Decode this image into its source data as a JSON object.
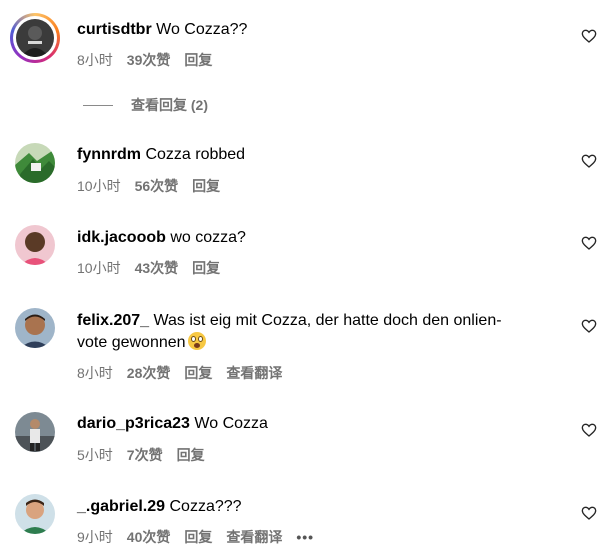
{
  "replies_link": "查看回复 (2)",
  "comments": [
    {
      "username": "curtisdtbr",
      "text": "Wo Cozza??",
      "time": "8小时",
      "likes": "39次赞",
      "reply": "回复"
    },
    {
      "username": "fynnrdm",
      "text": "Cozza robbed",
      "time": "10小时",
      "likes": "56次赞",
      "reply": "回复"
    },
    {
      "username": "idk.jacooob",
      "text": "wo cozza?",
      "time": "10小时",
      "likes": "43次赞",
      "reply": "回复"
    },
    {
      "username": "felix.207_",
      "text_line1": "Was ist eig mit Cozza, der hatte doch den onlien-",
      "text_line2": "vote gewonnen",
      "time": "8小时",
      "likes": "28次赞",
      "reply": "回复",
      "translate": "查看翻译"
    },
    {
      "username": "dario_p3rica23",
      "text": "Wo Cozza",
      "time": "5小时",
      "likes": "7次赞",
      "reply": "回复"
    },
    {
      "username": "_.gabriel.29",
      "text": "Cozza???",
      "time": "9小时",
      "likes": "40次赞",
      "reply": "回复",
      "translate": "查看翻译",
      "more": "•••"
    }
  ]
}
